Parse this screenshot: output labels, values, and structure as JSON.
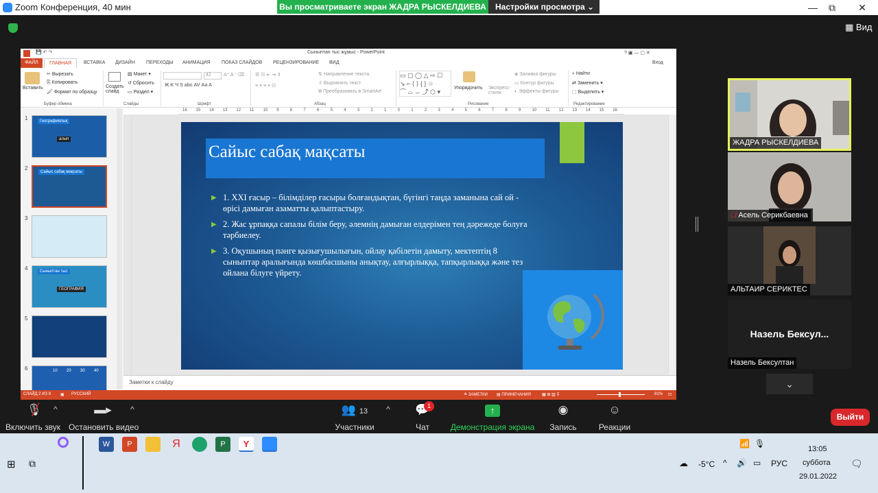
{
  "zoom": {
    "window_title": "Zoom Конференция, 40 мин",
    "share_notice": "Вы просматриваете экран ЖАДРА РЫСКЕЛДИЕВА",
    "view_options": "Настройки просмотра",
    "view_label": "Вид",
    "controls": {
      "minimize": "—",
      "maximize": "⧉",
      "close": "✕"
    }
  },
  "ppt": {
    "title": "Сыныптан тыс жұмыс - PowerPoint",
    "signin": "Вход",
    "menu": [
      "ФАЙЛ",
      "ГЛАВНАЯ",
      "ВСТАВКА",
      "ДИЗАЙН",
      "ПЕРЕХОДЫ",
      "АНИМАЦИЯ",
      "ПОКАЗ СЛАЙДОВ",
      "РЕЦЕНЗИРОВАНИЕ",
      "ВИД"
    ],
    "ribbon": {
      "paste": "Вставить",
      "cut": "Вырезать",
      "copy": "Копировать",
      "format_painter": "Формат по образцу",
      "clipboard": "Буфер обмена",
      "new_slide": "Создать слайд",
      "layout": "Макет",
      "reset": "Сбросить",
      "section": "Раздел",
      "slides": "Слайды",
      "font_size": "42",
      "font": "Шрифт",
      "text_direction": "Направление текста",
      "align_text": "Выровнять текст",
      "smartart": "Преобразовать в SmartArt",
      "paragraph": "Абзац",
      "arrange": "Упорядочить",
      "quick_styles": "Экспресс-стили",
      "shape_fill": "Заливка фигуры",
      "shape_outline": "Контур фигуры",
      "shape_effects": "Эффекты фигуры",
      "drawing": "Рисование",
      "find": "Найти",
      "replace": "Заменить",
      "select": "Выделить",
      "editing": "Редактирование"
    },
    "ruler_ticks": [
      "16",
      "15",
      "14",
      "13",
      "12",
      "11",
      "10",
      "9",
      "8",
      "7",
      "6",
      "5",
      "4",
      "3",
      "2",
      "1",
      "0",
      "1",
      "2",
      "3",
      "4",
      "5",
      "6",
      "7",
      "8",
      "9",
      "10",
      "11",
      "12",
      "13",
      "14",
      "15",
      "16"
    ],
    "thumbnails": [
      {
        "num": "1",
        "title": "Географиялық",
        "subtitle": "алып",
        "bg": "#1c5da8"
      },
      {
        "num": "2",
        "title": "Сайыс сабақ мақсаты",
        "bg": "#1d5a94"
      },
      {
        "num": "3",
        "bg": "#d5ecf7"
      },
      {
        "num": "4",
        "title": "Сыныптан тыс",
        "subtitle": "ГЕОГРАФИЯ",
        "bg": "#2a8ec2"
      },
      {
        "num": "5",
        "bg": "#12407a"
      },
      {
        "num": "6",
        "cells": [
          "10",
          "20",
          "30",
          "40"
        ],
        "bg": "#1e5fb0"
      }
    ],
    "slide": {
      "title": "Сайыс сабақ мақсаты",
      "bullets": [
        "1. XXI ғасыр – білімділер ғасыры болғандықтан, бүгінгі таңда заманына сай ой - өрісі дамыған азаматты қалыптастыру.",
        "2. Жас ұрпаққа сапалы білім беру, әлемнің дамыған елдерімен тең дәрежеде болуға тәрбиелеу.",
        "3. Оқушының пәнге қызығушылығын, ойлау қабілетін дамыту, мектептің 8 сыныптар аралығында көшбасшыны анықтау, алғырлыққа, тапқырлыққа және тез ойлана білуге үйрету."
      ]
    },
    "notes_placeholder": "Заметки к слайду",
    "status": {
      "slide": "СЛАЙД 2 ИЗ 9",
      "lang": "РУССКИЙ",
      "notes": "ЗАМЕТКИ",
      "comments": "ПРИМЕЧАНИЯ",
      "zoom": "81%"
    }
  },
  "participants": [
    {
      "name": "ЖАДРА РЫСКЕЛДИЕВА"
    },
    {
      "name": "Асель Серикбаевна"
    },
    {
      "name": "АЛЬТАИР СЕРИКТЕС"
    },
    {
      "name": "Назель  Бексултан",
      "display": "Назель   Бексул..."
    }
  ],
  "toolbar": {
    "mute": "Включить звук",
    "video": "Остановить видео",
    "participants": "Участники",
    "participants_count": "13",
    "chat": "Чат",
    "chat_badge": "1",
    "share": "Демонстрация экрана",
    "record": "Запись",
    "reactions": "Реакции",
    "leave": "Выйти"
  },
  "taskbar": {
    "weather": "-5°C",
    "lang": "РУС",
    "time": "13:05",
    "day": "суббота",
    "date": "29.01.2022"
  }
}
